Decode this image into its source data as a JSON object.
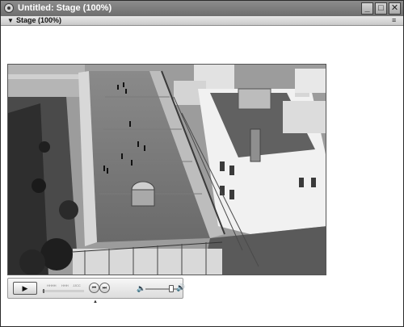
{
  "window": {
    "title": "Untitled: Stage (100%)"
  },
  "titlebar_buttons": {
    "minimize": "_",
    "maximize": "□",
    "close": "✕"
  },
  "panel": {
    "title": "Stage (100%)",
    "collapse_glyph": "▼",
    "options_glyph": "≡"
  },
  "video": {
    "description_icon": "rooftop-video-frame"
  },
  "controller": {
    "play_glyph": "▶",
    "time_ticks": [
      "HHHH",
      "HHH",
      "JJCC"
    ],
    "back_glyph": "⏮",
    "forward_glyph": "⏭",
    "volume_icon": "🔈",
    "volume_max_icon": "🔊",
    "volume_level": 0.8,
    "collapse_caret": "▲"
  },
  "colors": {
    "titlebar": "#7c7c7c",
    "stage_bg": "#ffffff"
  }
}
